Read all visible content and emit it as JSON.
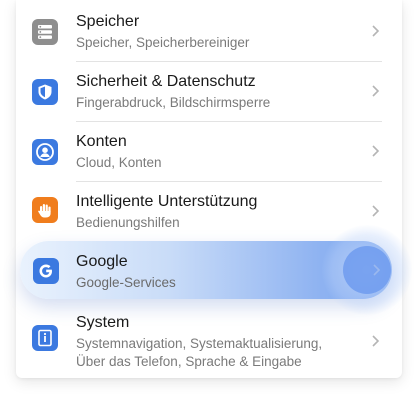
{
  "settings": {
    "items": [
      {
        "title": "Speicher",
        "subtitle": "Speicher, Speicherbereiniger",
        "icon": "storage-icon",
        "icon_color": "#8e8e8e"
      },
      {
        "title": "Sicherheit & Datenschutz",
        "subtitle": "Fingerabdruck, Bildschirmsperre",
        "icon": "shield-icon",
        "icon_color": "#3b79e0"
      },
      {
        "title": "Konten",
        "subtitle": "Cloud, Konten",
        "icon": "account-icon",
        "icon_color": "#3b79e0"
      },
      {
        "title": "Intelligente Unterstützung",
        "subtitle": "Bedienungshilfen",
        "icon": "hand-icon",
        "icon_color": "#f07d1d"
      },
      {
        "title": "Google",
        "subtitle": "Google-Services",
        "icon": "google-icon",
        "icon_color": "#3b79e0",
        "highlighted": true
      },
      {
        "title": "System",
        "subtitle_lines": [
          "Systemnavigation, Systemaktualisierung,",
          "Über das Telefon, Sprache & Eingabe"
        ],
        "icon": "system-info-icon",
        "icon_color": "#3b79e0"
      }
    ]
  }
}
